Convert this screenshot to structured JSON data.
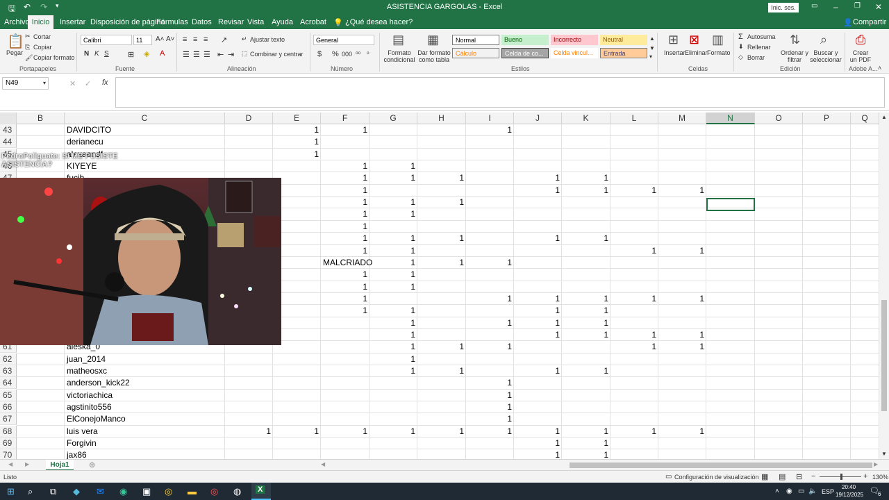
{
  "window": {
    "title": "ASISTENCIA GARGOLAS - Excel",
    "signin": "Inic. ses."
  },
  "menu": {
    "tabs": [
      "Archivo",
      "Inicio",
      "Insertar",
      "Disposición de página",
      "Fórmulas",
      "Datos",
      "Revisar",
      "Vista",
      "Ayuda",
      "Acrobat"
    ],
    "tellme": "¿Qué desea hacer?",
    "share": "Compartir"
  },
  "ribbon": {
    "clipboard": {
      "paste": "Pegar",
      "cut": "Cortar",
      "copy": "Copiar",
      "format_painter": "Copiar formato",
      "group": "Portapapeles"
    },
    "font": {
      "name": "Calibri",
      "size": "11",
      "group": "Fuente"
    },
    "alignment": {
      "wrap": "Ajustar texto",
      "merge": "Combinar y centrar",
      "group": "Alineación"
    },
    "number": {
      "format": "General",
      "group": "Número"
    },
    "styles": {
      "conditional": "Formato condicional",
      "as_table": "Dar formato como tabla",
      "normal": "Normal",
      "good": "Bueno",
      "bad": "Incorrecto",
      "neutral": "Neutral",
      "calc": "Cálculo",
      "check": "Celda de co...",
      "linked": "Celda vincul...",
      "input": "Entrada",
      "group": "Estilos"
    },
    "cells": {
      "insert": "Insertar",
      "delete": "Eliminar",
      "format": "Formato",
      "group": "Celdas"
    },
    "editing": {
      "autosum": "Autosuma",
      "fill": "Rellenar",
      "clear": "Borrar",
      "sort": "Ordenar y filtrar",
      "find": "Buscar y seleccionar",
      "group": "Edición"
    },
    "adobe": {
      "create_pdf": "Crear un PDF",
      "group": "Adobe A..."
    }
  },
  "formula_bar": {
    "name_box": "N49",
    "fx": "fx",
    "value": ""
  },
  "columns": [
    "B",
    "C",
    "D",
    "E",
    "F",
    "G",
    "H",
    "I",
    "J",
    "K",
    "L",
    "M",
    "N",
    "O",
    "P",
    "Q"
  ],
  "rows": [
    {
      "n": "43",
      "name": "DAVIDCITO",
      "cells": {
        "E": "1",
        "F": "1",
        "I": "1"
      }
    },
    {
      "n": "44",
      "name": "derianecu",
      "cells": {
        "E": "1"
      }
    },
    {
      "n": "45",
      "name": "alexaandf",
      "cells": {
        "E": "1"
      }
    },
    {
      "n": "46",
      "name": "KIYEYE",
      "cells": {
        "F": "1",
        "G": "1"
      }
    },
    {
      "n": "47",
      "name": "fucih",
      "cells": {
        "F": "1",
        "G": "1",
        "H": "1",
        "J": "1",
        "K": "1"
      }
    },
    {
      "n": "48",
      "name": "",
      "cells": {
        "F": "1",
        "J": "1",
        "K": "1",
        "L": "1",
        "M": "1"
      }
    },
    {
      "n": "49",
      "name": "",
      "cells": {
        "F": "1",
        "G": "1",
        "H": "1"
      }
    },
    {
      "n": "50",
      "name": "",
      "cells": {
        "F": "1",
        "G": "1"
      }
    },
    {
      "n": "51",
      "name": "",
      "cells": {
        "F": "1"
      }
    },
    {
      "n": "52",
      "name": "",
      "cells": {
        "F": "1",
        "G": "1",
        "H": "1",
        "J": "1",
        "K": "1"
      }
    },
    {
      "n": "53",
      "name": "",
      "cells": {
        "F": "1",
        "G": "1",
        "L": "1",
        "M": "1"
      }
    },
    {
      "n": "54",
      "name": "",
      "cells": {
        "F": "MALCRIADO",
        "G": "1",
        "H": "1",
        "I": "1"
      }
    },
    {
      "n": "55",
      "name": "",
      "cells": {
        "F": "1",
        "G": "1"
      }
    },
    {
      "n": "56",
      "name": "",
      "cells": {
        "F": "1",
        "G": "1"
      }
    },
    {
      "n": "57",
      "name": "",
      "cells": {
        "F": "1",
        "I": "1",
        "J": "1",
        "K": "1",
        "L": "1",
        "M": "1"
      }
    },
    {
      "n": "58",
      "name": "",
      "cells": {
        "F": "1",
        "G": "1",
        "J": "1",
        "K": "1"
      }
    },
    {
      "n": "59",
      "name": "",
      "cells": {
        "G": "1",
        "I": "1",
        "J": "1",
        "K": "1"
      }
    },
    {
      "n": "60",
      "name": "",
      "cells": {
        "G": "1",
        "J": "1",
        "K": "1",
        "L": "1",
        "M": "1"
      }
    },
    {
      "n": "61",
      "name": "aleska_0",
      "cells": {
        "G": "1",
        "H": "1",
        "I": "1",
        "L": "1",
        "M": "1"
      }
    },
    {
      "n": "62",
      "name": "juan_2014",
      "cells": {
        "G": "1"
      }
    },
    {
      "n": "63",
      "name": "matheosxc",
      "cells": {
        "G": "1",
        "H": "1",
        "J": "1",
        "K": "1"
      }
    },
    {
      "n": "64",
      "name": "anderson_kick22",
      "cells": {
        "I": "1"
      }
    },
    {
      "n": "65",
      "name": "victoriachica",
      "cells": {
        "I": "1"
      }
    },
    {
      "n": "66",
      "name": "agstinito556",
      "cells": {
        "I": "1"
      }
    },
    {
      "n": "67",
      "name": "ElConejoManco",
      "cells": {
        "I": "1"
      }
    },
    {
      "n": "68",
      "name": "luis vera",
      "cells": {
        "D": "1",
        "E": "1",
        "F": "1",
        "G": "1",
        "H": "1",
        "I": "1",
        "J": "1",
        "K": "1",
        "L": "1",
        "M": "1"
      }
    },
    {
      "n": "69",
      "name": "Forgivin",
      "cells": {
        "J": "1",
        "K": "1"
      }
    },
    {
      "n": "70",
      "name": "jax86",
      "cells": {
        "J": "1",
        "K": "1"
      }
    }
  ],
  "overlay": {
    "line1": "PedroPoliguate: SI ME PUSISTE",
    "line2": "ASISTENCIA?"
  },
  "sheet": {
    "tab": "Hoja1"
  },
  "status": {
    "ready": "Listo",
    "display_settings": "Configuración de visualización",
    "zoom": "130%"
  },
  "taskbar": {
    "lang": "ESP",
    "time": "20:40",
    "date": "19/12/2025",
    "notif": "6"
  },
  "colors": {
    "excel_green": "#217346"
  }
}
